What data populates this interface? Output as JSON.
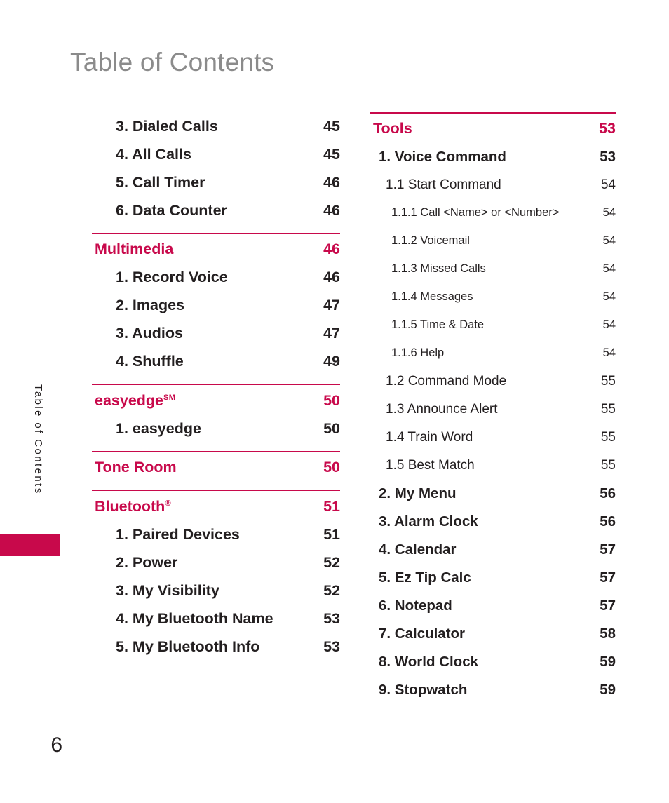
{
  "document": {
    "title": "Table of Contents",
    "side_tab_label": "Table of Contents",
    "page_number": "6",
    "accent_color": "#C8094B",
    "title_color": "#8B8B8B",
    "text_color": "#231F20"
  },
  "left_column": {
    "rows": [
      {
        "level": "item",
        "label": "3. Dialed Calls",
        "page": "45",
        "rule_above": false
      },
      {
        "level": "item",
        "label": "4. All Calls",
        "page": "45",
        "rule_above": false
      },
      {
        "level": "item",
        "label": "5. Call Timer",
        "page": "46",
        "rule_above": false
      },
      {
        "level": "item",
        "label": "6. Data Counter",
        "page": "46",
        "rule_above": false
      },
      {
        "level": "section",
        "label": "Multimedia",
        "page": "46",
        "rule_above": true
      },
      {
        "level": "item",
        "label": "1. Record Voice",
        "page": "46",
        "rule_above": false
      },
      {
        "level": "item",
        "label": "2. Images",
        "page": "47",
        "rule_above": false
      },
      {
        "level": "item",
        "label": "3. Audios",
        "page": "47",
        "rule_above": false
      },
      {
        "level": "item",
        "label": "4. Shuffle",
        "page": "49",
        "rule_above": false
      },
      {
        "level": "section",
        "label": "easyedge",
        "sup": "SM",
        "page": "50",
        "rule_above": true
      },
      {
        "level": "item",
        "label": "1. easyedge",
        "page": "50",
        "rule_above": false
      },
      {
        "level": "section",
        "label": "Tone Room",
        "page": "50",
        "rule_above": true
      },
      {
        "level": "section",
        "label": "Bluetooth",
        "sup": "®",
        "page": "51",
        "rule_above": true
      },
      {
        "level": "item",
        "label": "1. Paired Devices",
        "page": "51",
        "rule_above": false
      },
      {
        "level": "item",
        "label": "2. Power",
        "page": "52",
        "rule_above": false
      },
      {
        "level": "item",
        "label": "3. My Visibility",
        "page": "52",
        "rule_above": false
      },
      {
        "level": "item",
        "label": "4. My Bluetooth Name",
        "page": "53",
        "rule_above": false
      },
      {
        "level": "item",
        "label": "5. My Bluetooth Info",
        "page": "53",
        "rule_above": false
      }
    ]
  },
  "right_column": {
    "rows": [
      {
        "level": "section",
        "label": "Tools",
        "page": "53",
        "rule_above": true
      },
      {
        "level": "lvl1",
        "label": "1. Voice Command",
        "page": "53",
        "rule_above": false
      },
      {
        "level": "lvl2",
        "label": "1.1 Start Command",
        "page": "54",
        "rule_above": false
      },
      {
        "level": "lvl3",
        "label": "1.1.1  Call <Name> or <Number>",
        "page": "54",
        "rule_above": false
      },
      {
        "level": "lvl3",
        "label": "1.1.2 Voicemail",
        "page": "54",
        "rule_above": false
      },
      {
        "level": "lvl3",
        "label": "1.1.3 Missed Calls",
        "page": "54",
        "rule_above": false
      },
      {
        "level": "lvl3",
        "label": "1.1.4 Messages",
        "page": "54",
        "rule_above": false
      },
      {
        "level": "lvl3",
        "label": "1.1.5 Time & Date",
        "page": "54",
        "rule_above": false
      },
      {
        "level": "lvl3",
        "label": "1.1.6 Help",
        "page": "54",
        "rule_above": false
      },
      {
        "level": "lvl2",
        "label": "1.2 Command Mode",
        "page": "55",
        "rule_above": false
      },
      {
        "level": "lvl2",
        "label": "1.3 Announce Alert",
        "page": "55",
        "rule_above": false
      },
      {
        "level": "lvl2",
        "label": "1.4 Train Word",
        "page": "55",
        "rule_above": false
      },
      {
        "level": "lvl2",
        "label": "1.5 Best Match",
        "page": "55",
        "rule_above": false
      },
      {
        "level": "lvl1",
        "label": "2. My Menu",
        "page": "56",
        "rule_above": false
      },
      {
        "level": "lvl1",
        "label": "3. Alarm Clock",
        "page": "56",
        "rule_above": false
      },
      {
        "level": "lvl1",
        "label": "4. Calendar",
        "page": "57",
        "rule_above": false
      },
      {
        "level": "lvl1",
        "label": "5. Ez Tip Calc",
        "page": "57",
        "rule_above": false
      },
      {
        "level": "lvl1",
        "label": "6. Notepad",
        "page": "57",
        "rule_above": false
      },
      {
        "level": "lvl1",
        "label": "7. Calculator",
        "page": "58",
        "rule_above": false
      },
      {
        "level": "lvl1",
        "label": "8. World Clock",
        "page": "59",
        "rule_above": false
      },
      {
        "level": "lvl1",
        "label": "9. Stopwatch",
        "page": "59",
        "rule_above": false
      }
    ]
  }
}
